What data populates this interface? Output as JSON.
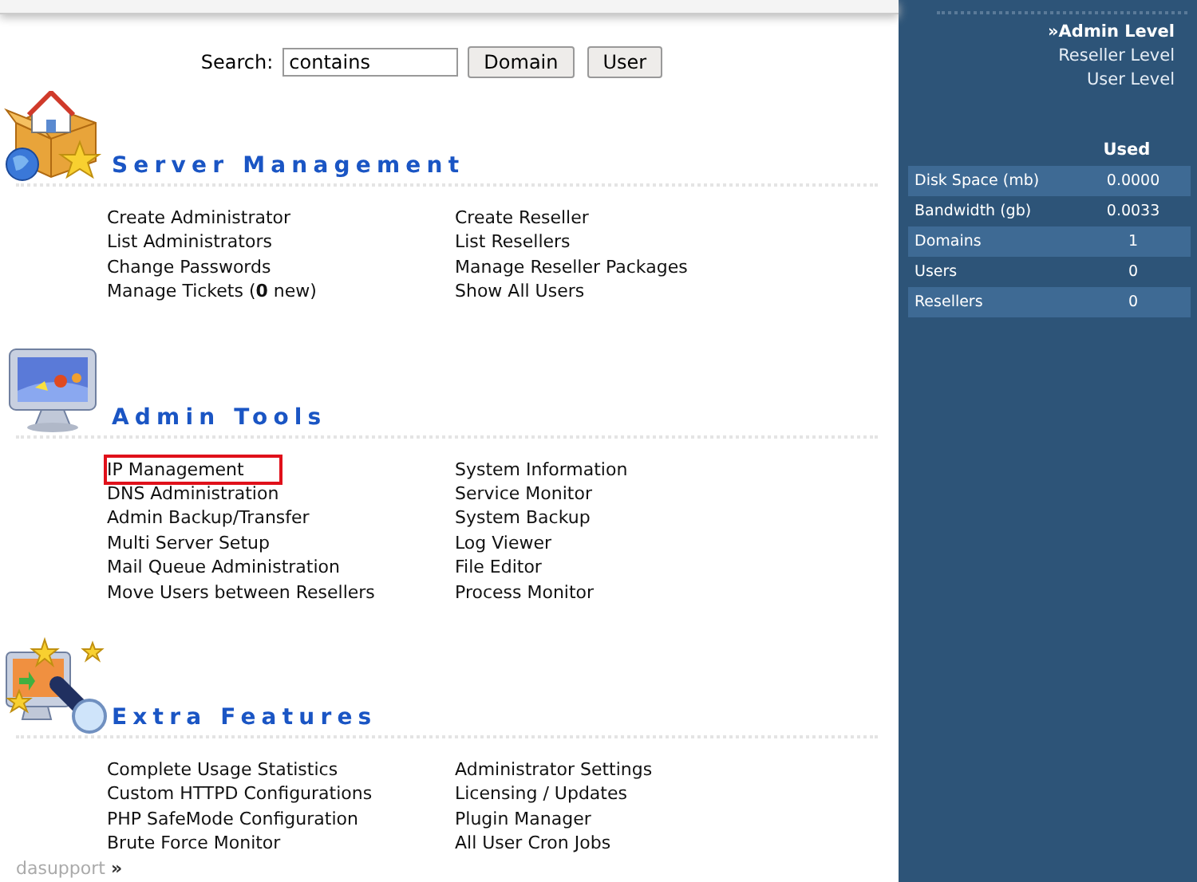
{
  "search": {
    "label": "Search:",
    "value": "contains",
    "buttons": [
      "Domain",
      "User"
    ]
  },
  "sections": [
    {
      "kind": "server",
      "title": "Server Management",
      "columns": [
        [
          {
            "label": "Create Administrator",
            "highlighted": false
          },
          {
            "label": "List Administrators",
            "highlighted": false
          },
          {
            "label": "Change Passwords",
            "highlighted": false
          },
          {
            "label": "Manage Tickets (**0** new)",
            "highlighted": false
          }
        ],
        [
          {
            "label": "Create Reseller",
            "highlighted": false
          },
          {
            "label": "List Resellers",
            "highlighted": false
          },
          {
            "label": "Manage Reseller Packages",
            "highlighted": false
          },
          {
            "label": "Show All Users",
            "highlighted": false
          }
        ]
      ]
    },
    {
      "kind": "admin",
      "title": "Admin Tools",
      "columns": [
        [
          {
            "label": "IP Management",
            "highlighted": true
          },
          {
            "label": "DNS Administration",
            "highlighted": false
          },
          {
            "label": "Admin Backup/Transfer",
            "highlighted": false
          },
          {
            "label": "Multi Server Setup",
            "highlighted": false
          },
          {
            "label": "Mail Queue Administration",
            "highlighted": false
          },
          {
            "label": "Move Users between Resellers",
            "highlighted": false
          }
        ],
        [
          {
            "label": "System Information",
            "highlighted": false
          },
          {
            "label": "Service Monitor",
            "highlighted": false
          },
          {
            "label": "System Backup",
            "highlighted": false
          },
          {
            "label": "Log Viewer",
            "highlighted": false
          },
          {
            "label": "File Editor",
            "highlighted": false
          },
          {
            "label": "Process Monitor",
            "highlighted": false
          }
        ]
      ]
    },
    {
      "kind": "extra",
      "title": "Extra Features",
      "columns": [
        [
          {
            "label": "Complete Usage Statistics",
            "highlighted": false
          },
          {
            "label": "Custom HTTPD Configurations",
            "highlighted": false
          },
          {
            "label": "PHP SafeMode Configuration",
            "highlighted": false
          },
          {
            "label": "Brute Force Monitor",
            "highlighted": false
          }
        ],
        [
          {
            "label": "Administrator Settings",
            "highlighted": false
          },
          {
            "label": "Licensing / Updates",
            "highlighted": false
          },
          {
            "label": "Plugin Manager",
            "highlighted": false
          },
          {
            "label": "All User Cron Jobs",
            "highlighted": false
          }
        ]
      ]
    }
  ],
  "footer": {
    "breadcrumb": "dasupport",
    "separator": "»"
  },
  "sidebar": {
    "levels": [
      {
        "label": "Admin Level",
        "marker": "»",
        "selected": true
      },
      {
        "label": "Reseller Level",
        "selected": false
      },
      {
        "label": "User Level",
        "selected": false
      }
    ],
    "usage": {
      "header": "Used",
      "rows": [
        {
          "name": "Disk Space (mb)",
          "value": "0.0000"
        },
        {
          "name": "Bandwidth (gb)",
          "value": "0.0033"
        },
        {
          "name": "Domains",
          "value": "1"
        },
        {
          "name": "Users",
          "value": "0"
        },
        {
          "name": "Resellers",
          "value": "0"
        }
      ]
    }
  }
}
